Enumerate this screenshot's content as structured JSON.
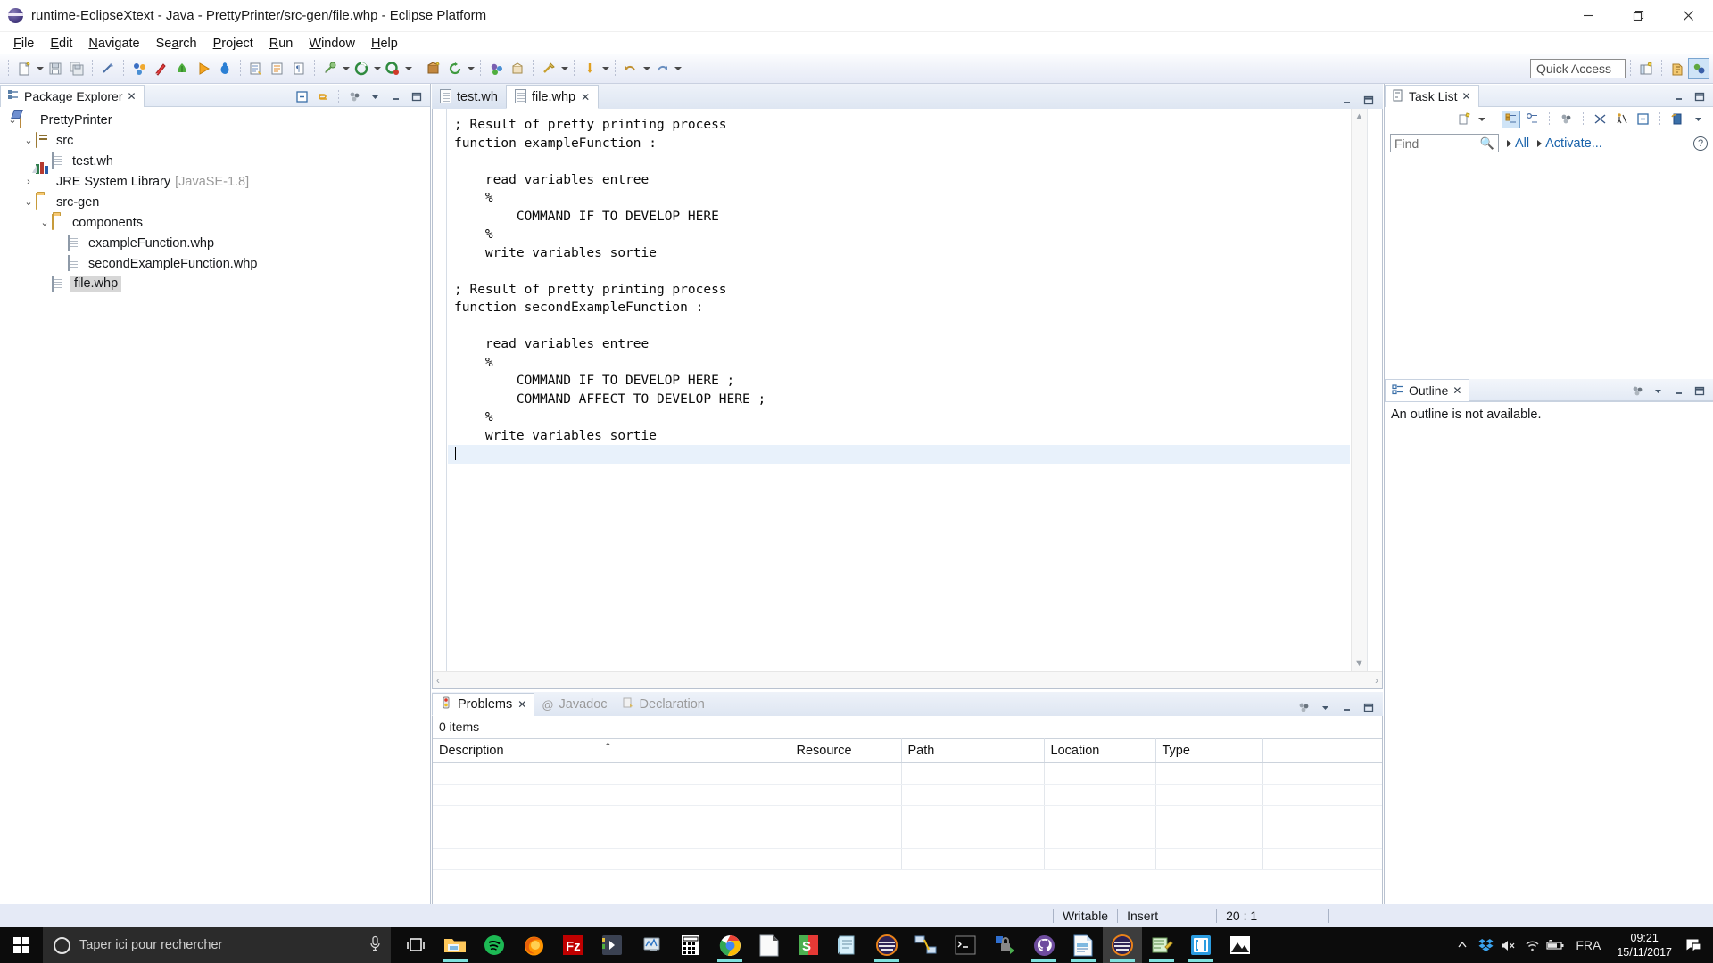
{
  "window": {
    "title": "runtime-EclipseXtext - Java - PrettyPrinter/src-gen/file.whp - Eclipse Platform",
    "app_icon": "eclipse-globe-icon",
    "minimize": "minimize-button",
    "restore": "restore-button",
    "close": "close-button"
  },
  "menubar": {
    "items": [
      {
        "label": "File",
        "mnemonic": "F"
      },
      {
        "label": "Edit",
        "mnemonic": "E"
      },
      {
        "label": "Navigate",
        "mnemonic": "N"
      },
      {
        "label": "Search",
        "mnemonic": "a"
      },
      {
        "label": "Project",
        "mnemonic": "P"
      },
      {
        "label": "Run",
        "mnemonic": "R"
      },
      {
        "label": "Window",
        "mnemonic": "W"
      },
      {
        "label": "Help",
        "mnemonic": "H"
      }
    ]
  },
  "toolbar": {
    "quick_access_placeholder": "Quick Access",
    "buttons": [
      "new-wizard-icon",
      "save-icon",
      "save-all-icon",
      "print-icon",
      "open-type-icon",
      "new-java-class-icon",
      "new-java-project-icon",
      "run-icon",
      "debug-icon",
      "next-annotation-icon",
      "previous-annotation-icon",
      "toggle-mark-occurrences-icon",
      "external-tools-icon",
      "run-last-tool-icon",
      "debug-last-icon",
      "new-package-icon",
      "refresh-icon",
      "open-perspective-icon",
      "search-icon",
      "pin-editor-icon"
    ],
    "right_buttons": [
      "open-perspective-icon",
      "java-perspective-icon",
      "debug-perspective-icon"
    ]
  },
  "package_explorer": {
    "title": "Package Explorer",
    "actions": [
      "collapse-all-icon",
      "link-with-editor-icon",
      "view-menu-icon",
      "minimize-icon",
      "maximize-icon"
    ],
    "tree": [
      {
        "label": "PrettyPrinter",
        "icon": "java-project-icon",
        "indent": 0,
        "twisty": "expanded",
        "selected": false
      },
      {
        "label": "src",
        "icon": "source-folder-icon",
        "indent": 1,
        "twisty": "expanded",
        "selected": false
      },
      {
        "label": "test.wh",
        "icon": "file-icon",
        "indent": 2,
        "twisty": "none",
        "selected": false
      },
      {
        "label": "JRE System Library",
        "suffix": "[JavaSE-1.8]",
        "icon": "jre-library-icon",
        "indent": 1,
        "twisty": "collapsed",
        "selected": false
      },
      {
        "label": "src-gen",
        "icon": "folder-icon",
        "indent": 1,
        "twisty": "expanded",
        "selected": false
      },
      {
        "label": "components",
        "icon": "folder-icon",
        "indent": 2,
        "twisty": "expanded",
        "selected": false
      },
      {
        "label": "exampleFunction.whp",
        "icon": "file-icon",
        "indent": 3,
        "twisty": "none",
        "selected": false
      },
      {
        "label": "secondExampleFunction.whp",
        "icon": "file-icon",
        "indent": 3,
        "twisty": "none",
        "selected": false
      },
      {
        "label": "file.whp",
        "icon": "file-icon",
        "indent": 2,
        "twisty": "none",
        "selected": true
      }
    ]
  },
  "editor": {
    "tabs": [
      {
        "label": "test.wh",
        "icon": "file-icon",
        "active": false,
        "closable": false
      },
      {
        "label": "file.whp",
        "icon": "file-icon",
        "active": true,
        "closable": true
      }
    ],
    "minimize": "minimize-icon",
    "maximize": "maximize-icon",
    "content_before": "; Result of pretty printing process\nfunction exampleFunction :\n\n    read variables entree\n    %\n        COMMAND IF TO DEVELOP HERE\n    %\n    write variables sortie\n\n; Result of pretty printing process\nfunction secondExampleFunction :\n\n    read variables entree\n    %\n        COMMAND IF TO DEVELOP HERE ;\n        COMMAND AFFECT TO DEVELOP HERE ;\n    %\n    write variables sortie\n",
    "current_line_text": ""
  },
  "problems": {
    "tabs": [
      {
        "label": "Problems",
        "icon": "problems-icon",
        "active": true,
        "closable": true
      },
      {
        "label": "Javadoc",
        "icon": "javadoc-icon",
        "active": false,
        "closable": false
      },
      {
        "label": "Declaration",
        "icon": "declaration-icon",
        "active": false,
        "closable": false
      }
    ],
    "items_count": "0 items",
    "columns": [
      "Description",
      "Resource",
      "Path",
      "Location",
      "Type"
    ],
    "rows": [],
    "empty_row_count": 5,
    "sorted_column": "Description",
    "sort_direction": "ascending",
    "actions": [
      "view-menu-icon",
      "minimize-icon",
      "maximize-icon"
    ]
  },
  "task_list": {
    "title": "Task List",
    "find_placeholder": "Find",
    "find_value": "",
    "filter_all": "All",
    "filter_activate": "Activate...",
    "toolbar_icons": [
      "new-task-icon",
      "dropdown-arrow-icon",
      "categorized-presentation-icon",
      "scheduled-presentation-icon",
      "focus-on-workweek-icon",
      "collapse-all-icon",
      "filter-icon",
      "restore-tasks-icon",
      "synchronize-icon",
      "view-menu-icon"
    ],
    "help_icon": "help-icon",
    "minimize": "minimize-icon",
    "maximize": "maximize-icon"
  },
  "outline": {
    "title": "Outline",
    "message": "An outline is not available.",
    "actions": [
      "view-menu-icon",
      "minimize-icon",
      "maximize-icon"
    ]
  },
  "status_bar": {
    "writable": "Writable",
    "insert_mode": "Insert",
    "cursor_position": "20 : 1"
  },
  "taskbar": {
    "search_placeholder": "Taper ici pour rechercher",
    "start_icon": "windows-start-icon",
    "cortana_icon": "cortana-icon",
    "mic_icon": "microphone-icon",
    "task_view_icon": "task-view-icon",
    "apps": [
      {
        "name": "file-explorer-icon",
        "running": true
      },
      {
        "name": "spotify-icon",
        "running": false
      },
      {
        "name": "firefox-icon",
        "running": false
      },
      {
        "name": "filezilla-icon",
        "running": false
      },
      {
        "name": "sublime-text-icon",
        "running": false
      },
      {
        "name": "system-monitor-icon",
        "running": false
      },
      {
        "name": "calculator-icon",
        "running": false
      },
      {
        "name": "google-chrome-icon",
        "running": true
      },
      {
        "name": "libreoffice-writer-icon",
        "running": false
      },
      {
        "name": "skype-icon",
        "running": false
      },
      {
        "name": "notepad-icon",
        "running": false
      },
      {
        "name": "eclipse-icon",
        "running": true
      },
      {
        "name": "network-tool-icon",
        "running": false
      },
      {
        "name": "terminal-icon",
        "running": false
      },
      {
        "name": "lock-tool-icon",
        "running": false
      },
      {
        "name": "github-desktop-icon",
        "running": true
      },
      {
        "name": "libreoffice-impress-icon",
        "running": true
      },
      {
        "name": "eclipse-icon",
        "running": true,
        "active": true
      },
      {
        "name": "notepadpp-icon",
        "running": true
      },
      {
        "name": "brackets-icon",
        "running": true
      },
      {
        "name": "photos-icon",
        "running": false
      }
    ],
    "tray": {
      "expand_icon": "show-hidden-icons-icon",
      "dropbox_icon": "dropbox-icon",
      "volume_icon": "volume-muted-icon",
      "network_icon": "wifi-icon",
      "battery_icon": "battery-charging-icon",
      "language": "FRA",
      "time": "09:21",
      "date": "15/11/2017",
      "action_center_icon": "action-center-icon"
    }
  },
  "colors": {
    "accent_blue": "#1862ab",
    "selection": "#d7d7d7",
    "current_line": "#e8f1fb",
    "panel_border": "#b9c2d0",
    "toolbar_bg": "#eef1f9",
    "status_bg": "#e5eaf6",
    "taskbar_bg": "#0c0c0c"
  }
}
